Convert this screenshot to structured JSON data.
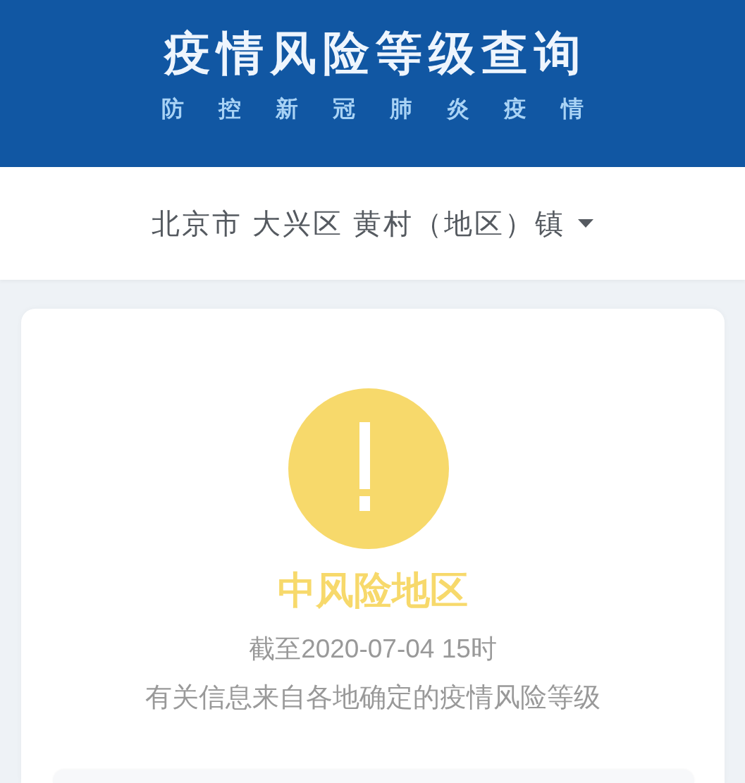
{
  "header": {
    "title": "疫情风险等级查询",
    "subtitle": "防 控 新 冠 肺 炎 疫 情"
  },
  "region_selector": {
    "value": "北京市 大兴区 黄村（地区）镇"
  },
  "result": {
    "kind": "medium",
    "level_label": "中风险地区",
    "as_of": "截至2020-07-04 15时",
    "note": "有关信息来自各地确定的疫情风险等级"
  }
}
